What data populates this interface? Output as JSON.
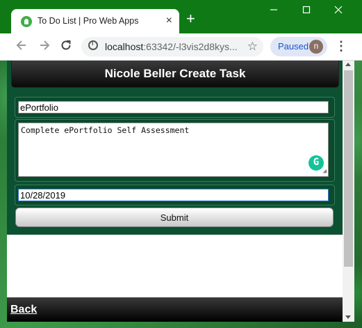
{
  "browser": {
    "tab_title": "To Do List | Pro Web Apps",
    "tab_close": "×",
    "new_tab": "+",
    "url_host": "localhost",
    "url_rest": ":63342/-l3vis2d8kys...",
    "profile_status": "Paused",
    "profile_initial": "n"
  },
  "app": {
    "header_title": "Nicole Beller Create Task",
    "task_title_value": "ePortfolio",
    "task_description_value": "Complete ePortfolio Self Assessment",
    "due_date_value": "10/28/2019",
    "submit_label": "Submit",
    "back_label": "Back"
  },
  "colors": {
    "titlebar": "#0f7a15",
    "app_background": "#0c5132",
    "header_dark": "#0a0a0a",
    "accent_blue": "#1a55c7",
    "grammarly": "#15c39a"
  }
}
